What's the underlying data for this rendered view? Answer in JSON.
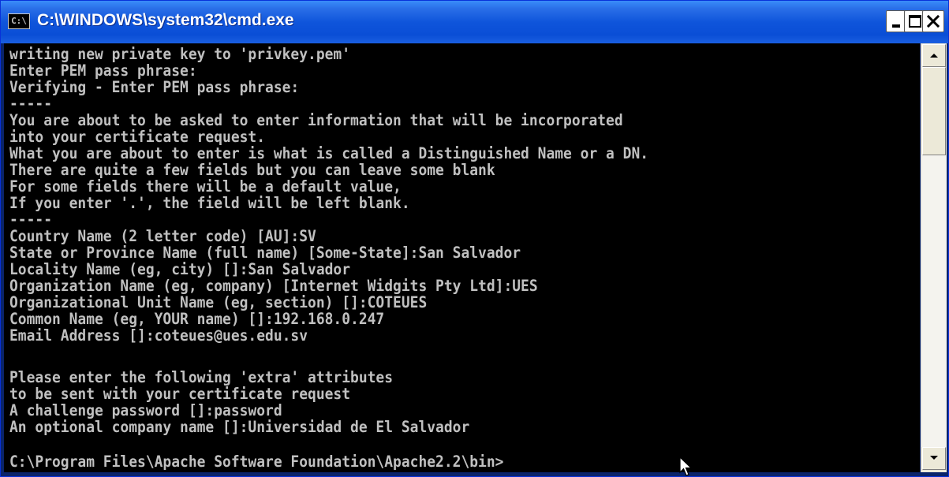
{
  "window": {
    "title": "C:\\WINDOWS\\system32\\cmd.exe",
    "icon_label": "C:\\",
    "icon_name": "cmd-icon"
  },
  "title_buttons": {
    "minimize": "minimize-icon",
    "maximize": "maximize-icon",
    "close": "close-icon"
  },
  "colors": {
    "console_bg": "#000000",
    "console_text": "#c0c0c0",
    "titlebar": "#0f55db"
  },
  "console": {
    "lines": [
      "writing new private key to 'privkey.pem'",
      "Enter PEM pass phrase:",
      "Verifying - Enter PEM pass phrase:",
      "-----",
      "You are about to be asked to enter information that will be incorporated",
      "into your certificate request.",
      "What you are about to enter is what is called a Distinguished Name or a DN.",
      "There are quite a few fields but you can leave some blank",
      "For some fields there will be a default value,",
      "If you enter '.', the field will be left blank.",
      "-----",
      "Country Name (2 letter code) [AU]:SV",
      "State or Province Name (full name) [Some-State]:San Salvador",
      "Locality Name (eg, city) []:San Salvador",
      "Organization Name (eg, company) [Internet Widgits Pty Ltd]:UES",
      "Organizational Unit Name (eg, section) []:COTEUES",
      "Common Name (eg, YOUR name) []:192.168.0.247",
      "Email Address []:coteues@ues.edu.sv",
      "",
      "Please enter the following 'extra' attributes",
      "to be sent with your certificate request",
      "A challenge password []:password",
      "An optional company name []:Universidad de El Salvador",
      "",
      "C:\\Program Files\\Apache Software Foundation\\Apache2.2\\bin>"
    ]
  }
}
